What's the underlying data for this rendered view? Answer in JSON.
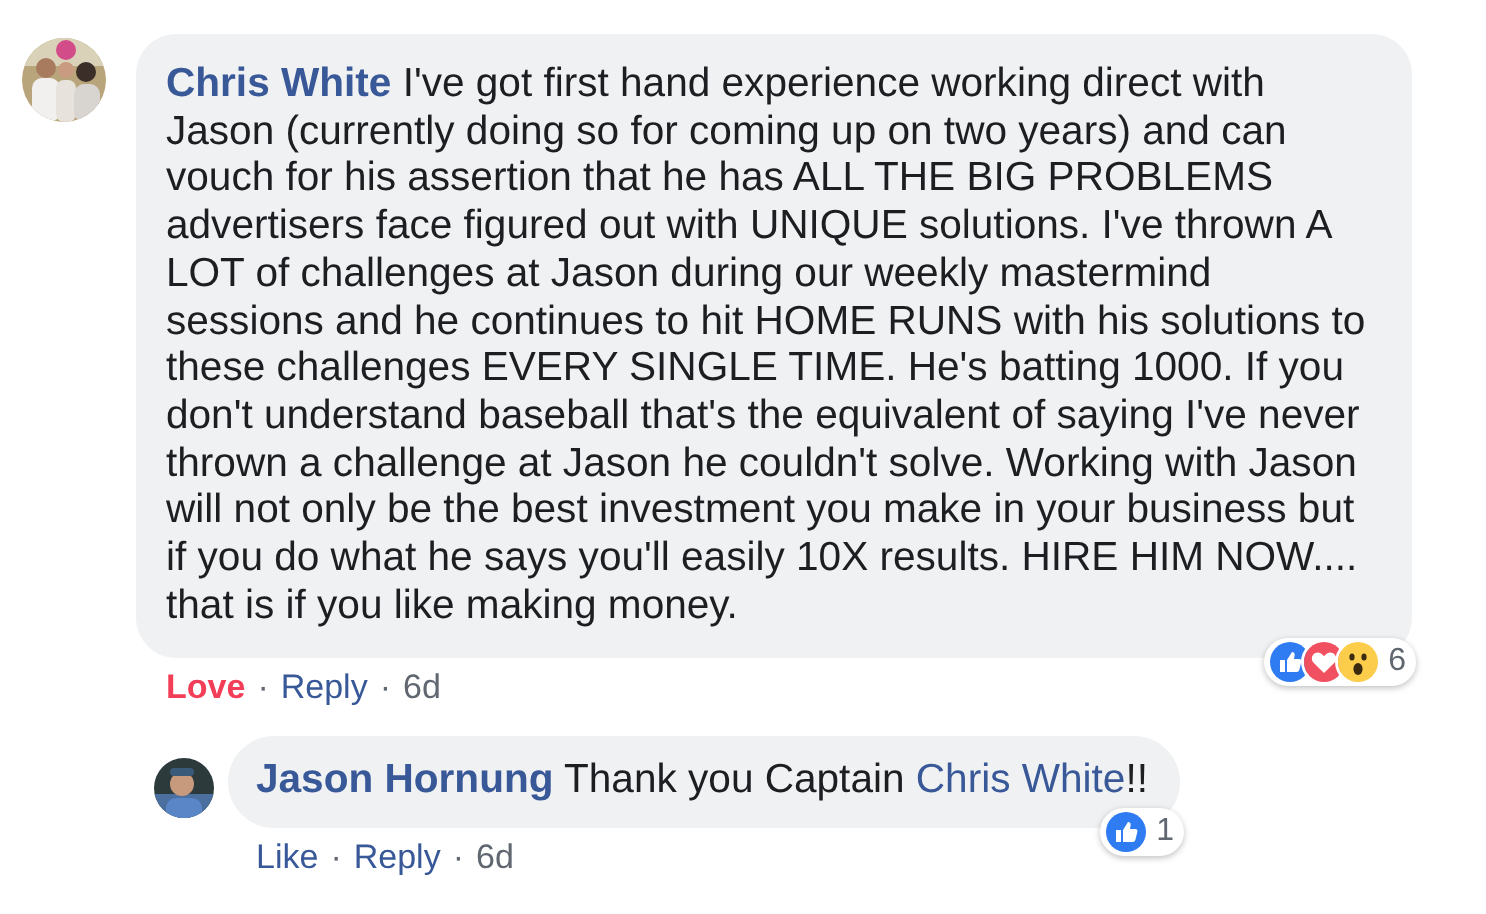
{
  "comments": [
    {
      "author": "Chris White",
      "parts": [
        {
          "kind": "text",
          "text": "I've got first hand experience working direct with Jason (currently doing so for coming up on two years) and can vouch for his assertion that he has ALL THE BIG PROBLEMS advertisers face figured out with UNIQUE solutions. I've thrown A LOT of challenges at Jason during our weekly mastermind sessions and he continues to hit HOME RUNS with his solutions to these challenges EVERY SINGLE TIME. He's batting 1000. If you don't understand baseball that's the equivalent of saying I've never thrown a challenge at Jason he couldn't solve. Working with Jason will not only be the best investment you make in your business but if you do what he says you'll easily 10X results. HIRE HIM NOW.... that is if you like making money."
        }
      ],
      "reactions": [
        {
          "kind": "like"
        },
        {
          "kind": "love"
        },
        {
          "kind": "wow"
        }
      ],
      "reaction_count": "6",
      "separator": "·",
      "actions": [
        {
          "label": "Love",
          "active": true
        },
        {
          "label": "Reply",
          "active": false
        }
      ],
      "time": "6d",
      "replies": [
        {
          "author": "Jason Hornung",
          "parts": [
            {
              "kind": "text",
              "text": "Thank you Captain "
            },
            {
              "kind": "mention",
              "text": "Chris White"
            },
            {
              "kind": "text",
              "text": "!!"
            }
          ],
          "reactions": [
            {
              "kind": "like"
            }
          ],
          "reaction_count": "1",
          "separator": "·",
          "actions": [
            {
              "label": "Like",
              "active": false
            },
            {
              "label": "Reply",
              "active": false
            }
          ],
          "time": "6d"
        }
      ]
    }
  ]
}
